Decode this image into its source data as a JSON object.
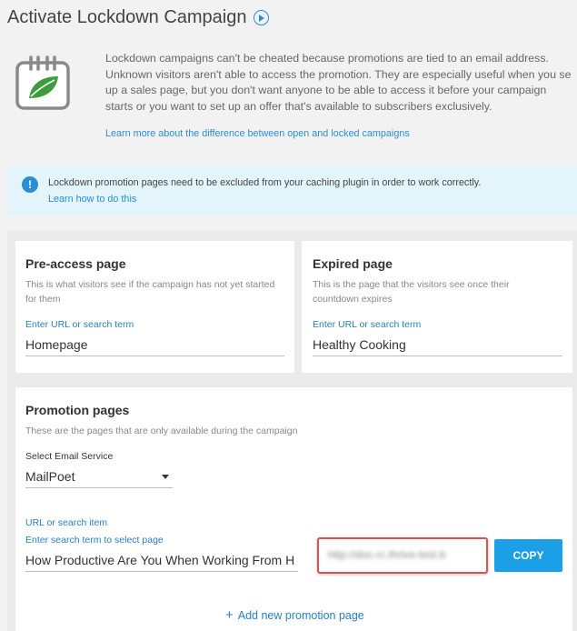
{
  "header": {
    "title": "Activate Lockdown Campaign",
    "play_icon": "play-circle-icon"
  },
  "intro": {
    "icon": "calendar-leaf-icon",
    "lines": [
      "Lockdown campaigns can't be cheated because promotions are tied to an email address.",
      "Unknown visitors aren't able to access the promotion. They are especially useful when you se",
      "up a sales page, but you don't want anyone to be able to access it before your campaign",
      "starts or you want to set up an offer that's available to subscribers exclusively."
    ],
    "link": "Learn more about the difference between open and locked campaigns"
  },
  "notice": {
    "icon": "info-icon",
    "icon_glyph": "!",
    "text": "Lockdown promotion pages need to be excluded from your caching plugin in order to work correctly.",
    "link": "Learn how to do this"
  },
  "pre_access": {
    "title": "Pre-access page",
    "desc_lines": [
      "This is what visitors see if the campaign has not yet started",
      "for them"
    ],
    "field_label": "Enter URL or search term",
    "value": "Homepage"
  },
  "expired": {
    "title": "Expired page",
    "desc_lines": [
      "This is the page that the visitors see once their",
      "countdown expires"
    ],
    "field_label": "Enter URL or search term",
    "value": "Healthy Cooking"
  },
  "promotion": {
    "title": "Promotion pages",
    "desc": "These are the pages that are only available during the campaign",
    "email_label": "Select Email Service",
    "email_value": "MailPoet",
    "url_label": "URL or search item",
    "search_label": "Enter search term to select page",
    "search_value": "How Productive Are You When Working From H",
    "url_value": "http://doc-rc.thrive-test.b",
    "copy_label": "COPY",
    "add_label": "Add new promotion page"
  },
  "colors": {
    "accent": "#2a8fd0",
    "copy_button": "#1ba0e8",
    "highlight_border": "#d9534f",
    "notice_bg": "#e3f4fa"
  }
}
